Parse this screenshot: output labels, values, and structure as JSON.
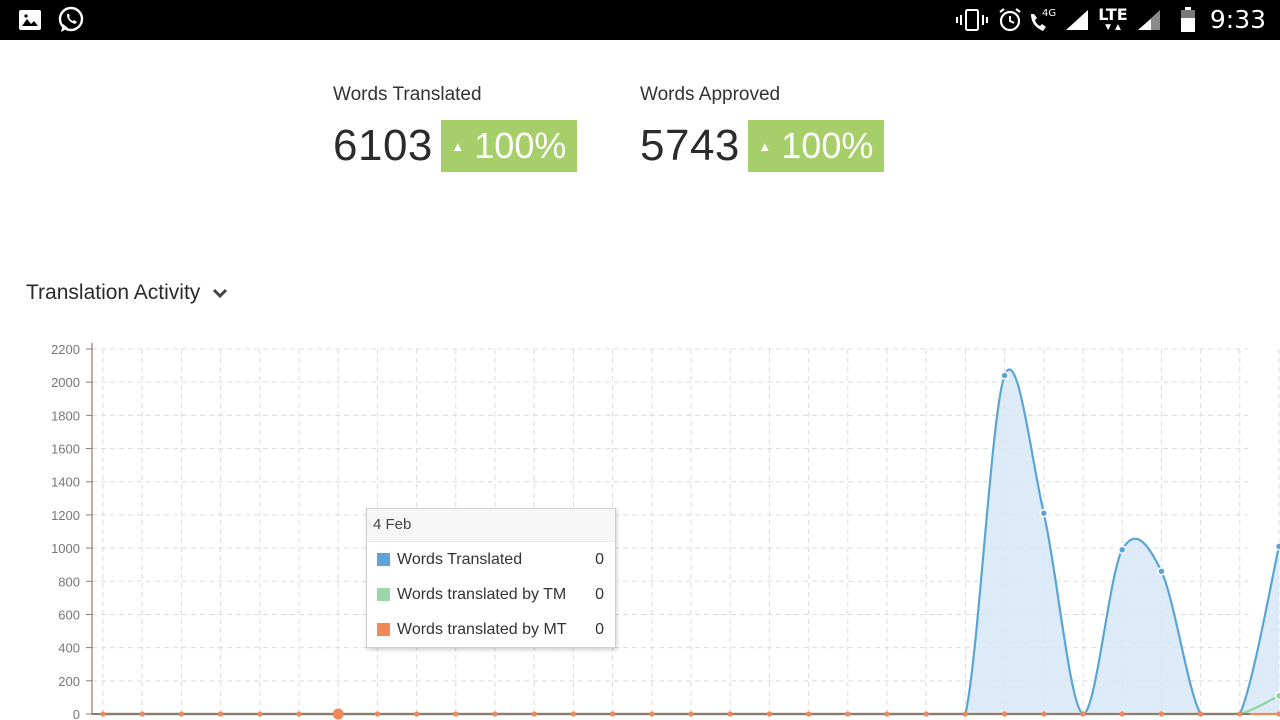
{
  "status_bar": {
    "time": "9:33",
    "network_label": "LTE",
    "gen_label": "4G",
    "left_icons": [
      "image-icon",
      "whatsapp-icon"
    ],
    "right_icons": [
      "vibrate-icon",
      "alarm-icon",
      "wifi-calling-icon",
      "signal-icon",
      "lte-icon",
      "signal-icon",
      "battery-icon"
    ]
  },
  "stats": [
    {
      "label": "Words Translated",
      "value": "6103",
      "change": "100%",
      "trend": "up"
    },
    {
      "label": "Words Approved",
      "value": "5743",
      "change": "100%",
      "trend": "up"
    }
  ],
  "section": {
    "title": "Translation Activity",
    "toggle_icon": "chevron-down-icon"
  },
  "colors": {
    "badge": "#a6cf6a",
    "translated": "#5aa5d6",
    "translated_fill": "#d6e8f6",
    "tm": "#8fd4a3",
    "mt": "#f0885a",
    "axis": "#8a7b75",
    "grid": "#dcdcdc"
  },
  "tooltip": {
    "date": "4 Feb",
    "rows": [
      {
        "label": "Words Translated",
        "value": "0",
        "color": "#5ba5d9"
      },
      {
        "label": "Words translated by TM",
        "value": "0",
        "color": "#9ad7a8"
      },
      {
        "label": "Words translated by MT",
        "value": "0",
        "color": "#f08a5d"
      }
    ]
  },
  "chart_data": {
    "type": "area",
    "ylim": [
      0,
      2200
    ],
    "y_ticks": [
      0,
      200,
      400,
      600,
      800,
      1000,
      1200,
      1400,
      1600,
      1800,
      2000,
      2200
    ],
    "grid": true,
    "x_count": 30,
    "highlight_index": 6,
    "series": [
      {
        "name": "Words Translated",
        "values": [
          0,
          0,
          0,
          0,
          0,
          0,
          0,
          0,
          0,
          0,
          0,
          0,
          0,
          0,
          0,
          0,
          0,
          0,
          0,
          0,
          0,
          0,
          0,
          2040,
          1210,
          0,
          990,
          860,
          0,
          0,
          1010
        ]
      },
      {
        "name": "Words translated by TM",
        "values": [
          0,
          0,
          0,
          0,
          0,
          0,
          0,
          0,
          0,
          0,
          0,
          0,
          0,
          0,
          0,
          0,
          0,
          0,
          0,
          0,
          0,
          0,
          0,
          0,
          0,
          0,
          0,
          0,
          0,
          0,
          110
        ]
      },
      {
        "name": "Words translated by MT",
        "values": [
          0,
          0,
          0,
          0,
          0,
          0,
          0,
          0,
          0,
          0,
          0,
          0,
          0,
          0,
          0,
          0,
          0,
          0,
          0,
          0,
          0,
          0,
          0,
          0,
          0,
          0,
          0,
          0,
          0,
          0,
          0
        ]
      }
    ]
  }
}
